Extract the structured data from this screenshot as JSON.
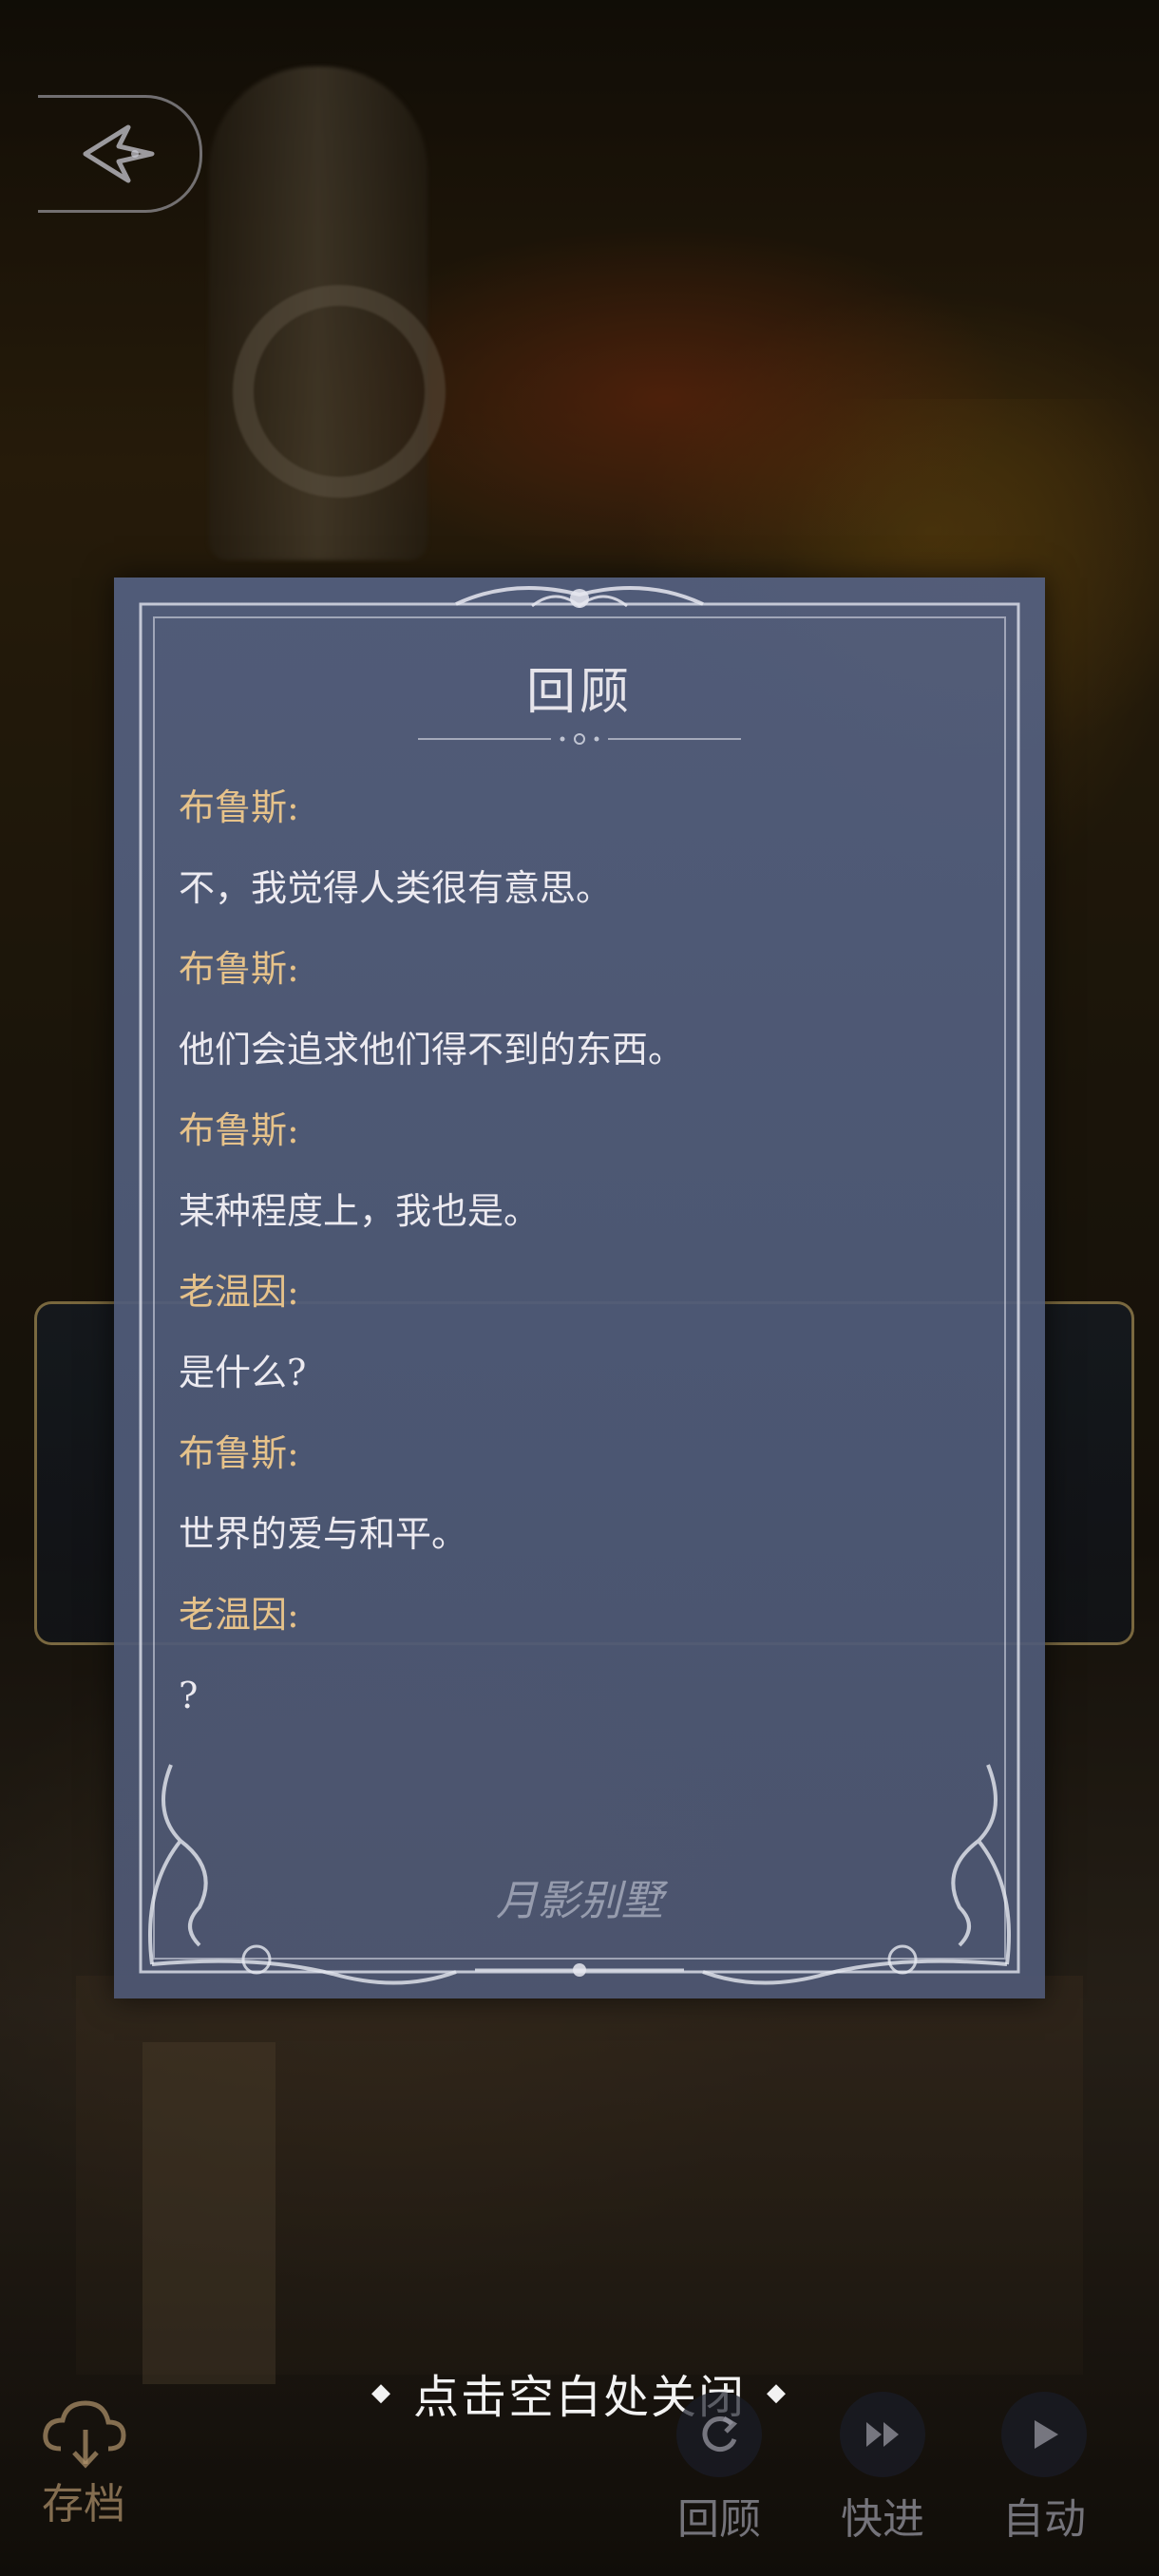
{
  "panel": {
    "title": "回顾",
    "entries": [
      {
        "speaker": "布鲁斯:",
        "text": "不，我觉得人类很有意思。"
      },
      {
        "speaker": "布鲁斯:",
        "text": "他们会追求他们得不到的东西。"
      },
      {
        "speaker": "布鲁斯:",
        "text": "某种程度上，我也是。"
      },
      {
        "speaker": "老温因:",
        "text": "是什么?"
      },
      {
        "speaker": "布鲁斯:",
        "text": "世界的爱与和平。"
      },
      {
        "speaker": "老温因:",
        "text": "?"
      }
    ],
    "logo_text": "月影别墅"
  },
  "hint": {
    "text": "点击空白处关闭"
  },
  "controls": {
    "save": "存档",
    "review": "回顾",
    "fast_forward": "快进",
    "auto": "自动"
  },
  "colors": {
    "speaker": "#e6c28a",
    "text": "#eceaf0",
    "panel": "#54607f"
  }
}
